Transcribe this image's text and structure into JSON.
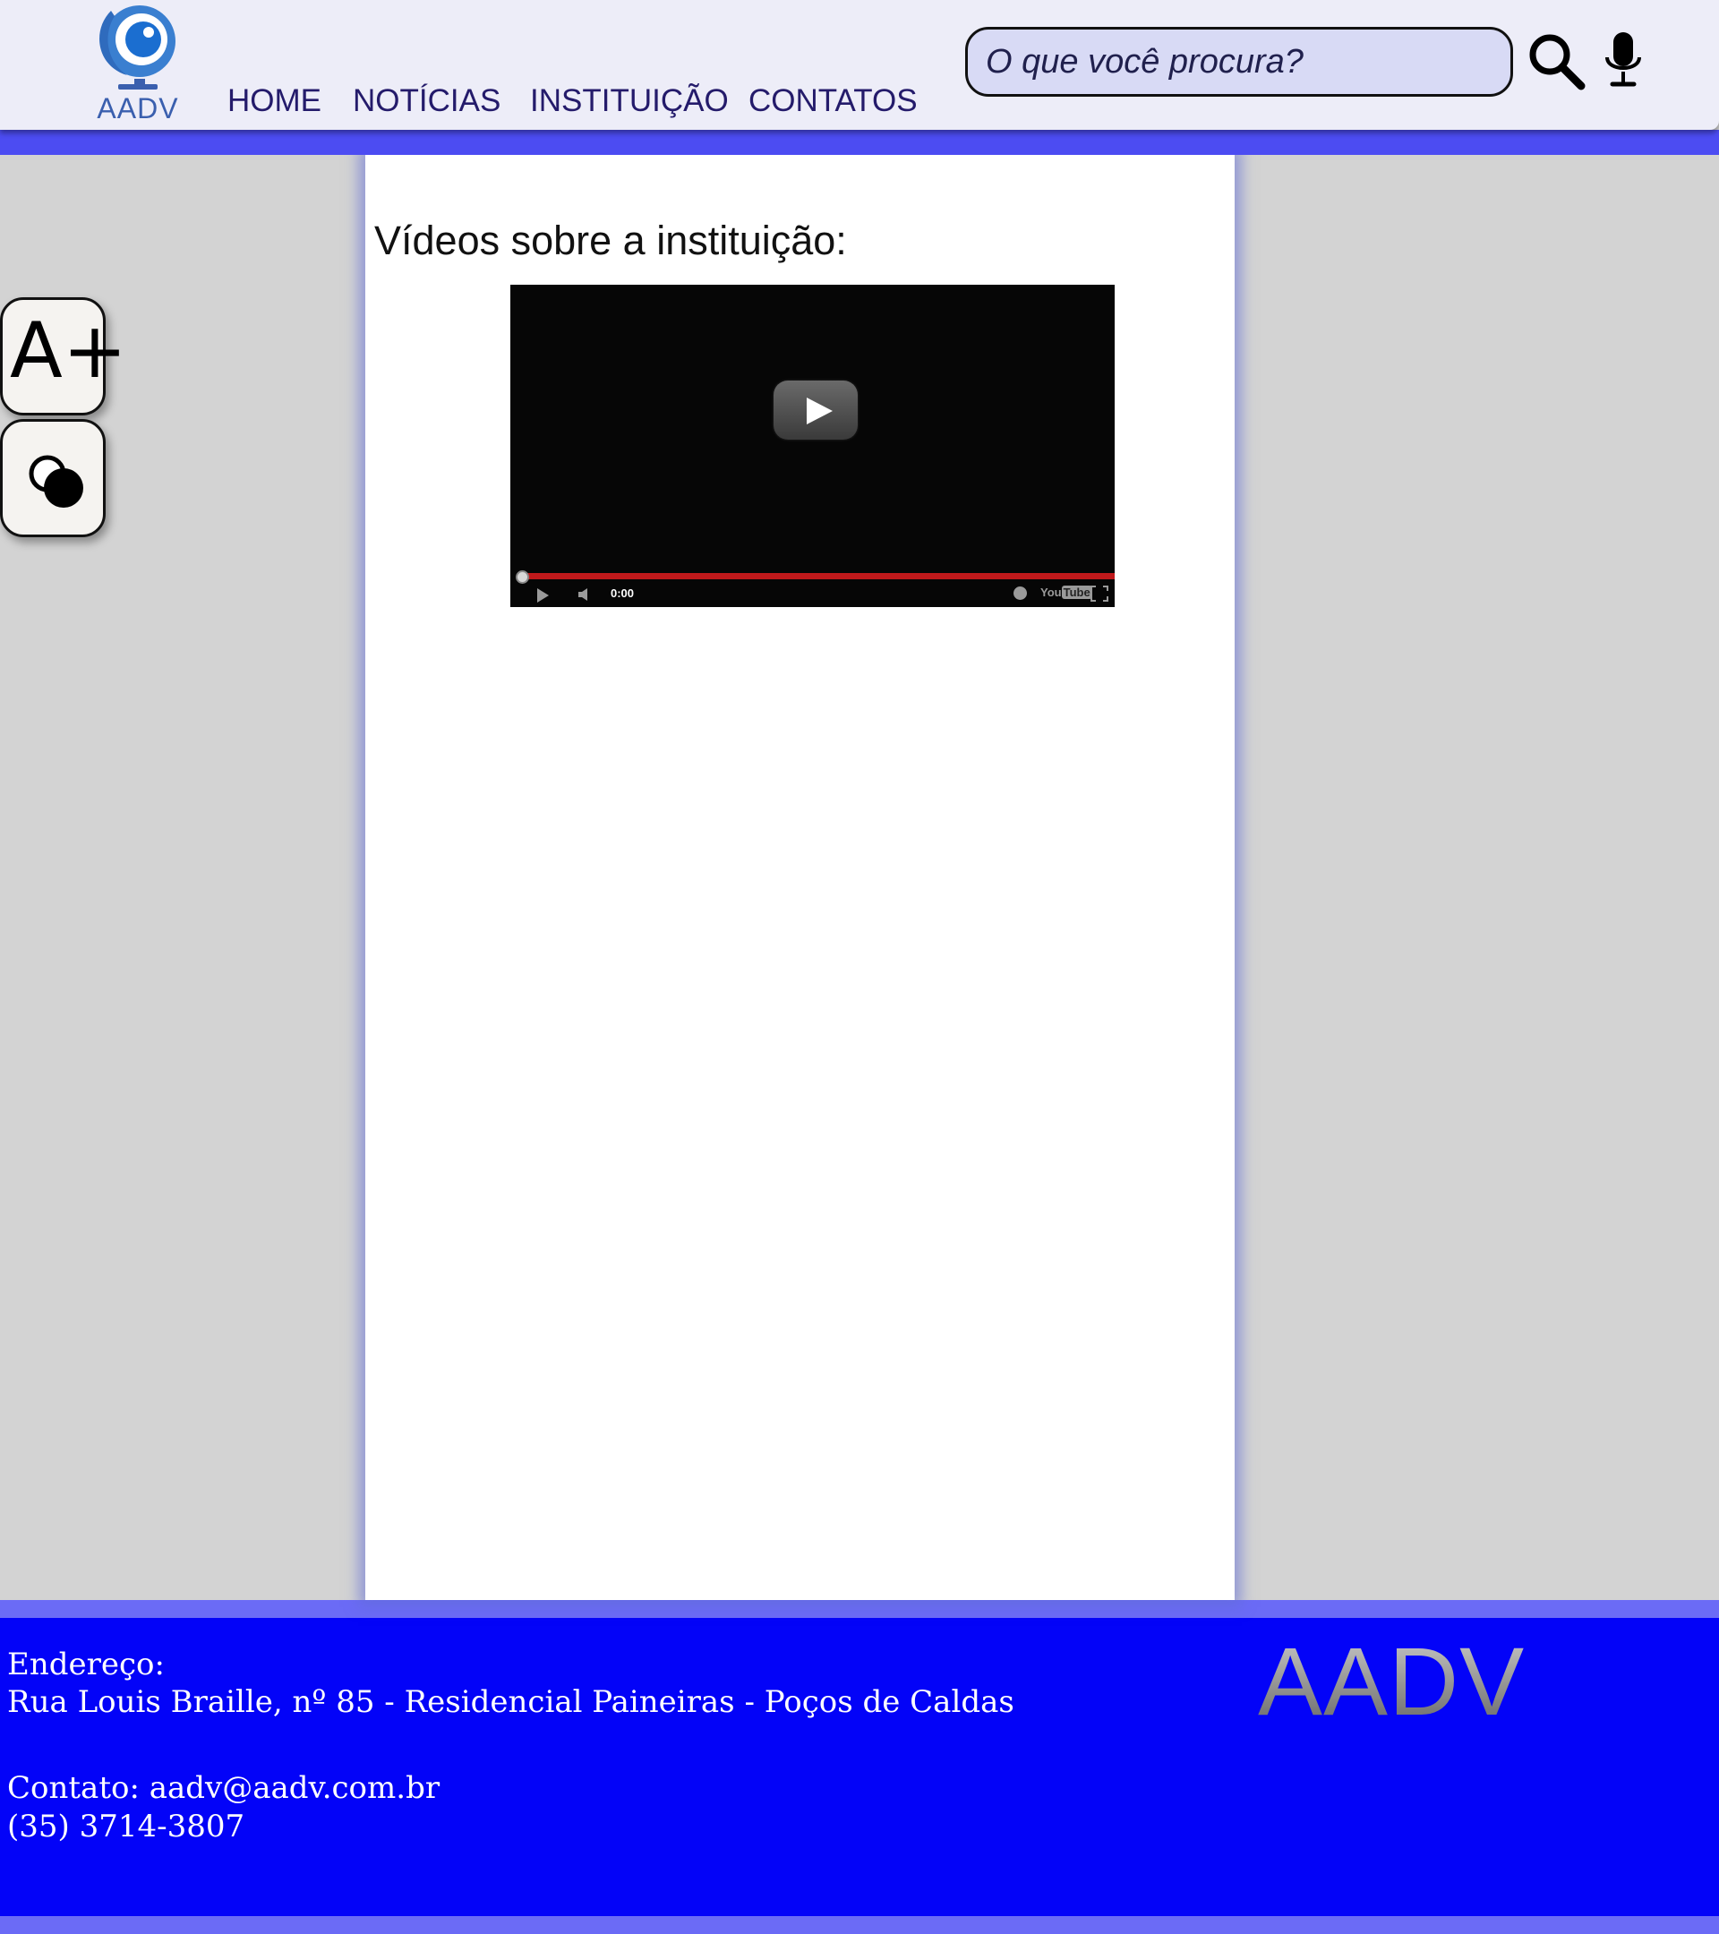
{
  "header": {
    "logo_text": "AADV",
    "nav": [
      {
        "label": "HOME"
      },
      {
        "label": "NOTÍCIAS"
      },
      {
        "label": "INSTITUIÇÃO"
      },
      {
        "label": "CONTATOS"
      }
    ],
    "search": {
      "placeholder": "O que você procura?"
    },
    "icons": [
      "search-icon",
      "microphone-icon"
    ]
  },
  "accessibility": {
    "font_button_label": "A+",
    "contrast_icon": "contrast-icon"
  },
  "main": {
    "title": "Vídeos sobre a instituição:",
    "video": {
      "time": "0:00",
      "brand_you": "You",
      "brand_tube": "Tube",
      "progress": 0
    }
  },
  "footer": {
    "address_label": "Endereço:",
    "address": "Rua Louis Braille, nº 85 - Residencial Paineiras - Poços de Caldas",
    "contact": "Contato: aadv@aadv.com.br",
    "phone": "(35) 3714-3807",
    "brand": "AADV"
  },
  "colors": {
    "header_bg": "#ededf8",
    "accent_band": "#4c4cf2",
    "nav_text": "#241b6b",
    "footer_bg": "#0303f8",
    "page_bg": "#d3d3d3"
  }
}
